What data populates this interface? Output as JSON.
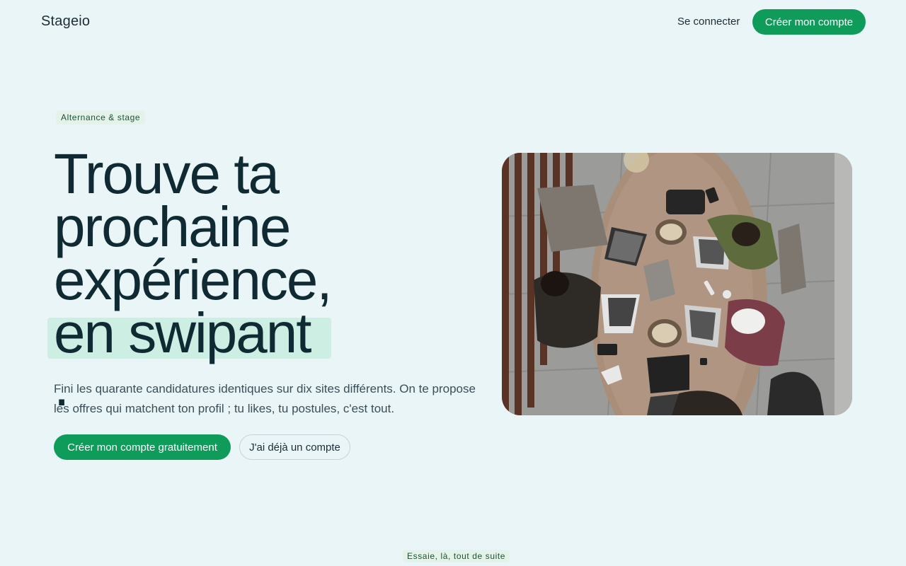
{
  "header": {
    "brand": "Stageio",
    "login_label": "Se connecter",
    "signup_label": "Créer mon compte"
  },
  "hero": {
    "tag": "Alternance & stage",
    "headline_lines": [
      "Trouve ta",
      "prochaine",
      "expérience,"
    ],
    "headline_highlight": "en swipant",
    "headline_end": ".",
    "lead": "Fini les quarante candidatures identiques sur dix sites différents. On te propose les offres qui matchent ton profil ; tu likes, tu postules, c'est tout.",
    "cta_primary": "Créer mon compte gratuitement",
    "cta_secondary": "J'ai déjà un compte"
  },
  "next_section": {
    "tag": "Essaie, là, tout de suite"
  },
  "colors": {
    "background": "#eaf5f7",
    "accent": "#0f9b59",
    "highlight": "#cdeee2",
    "text": "#0f2a33"
  }
}
